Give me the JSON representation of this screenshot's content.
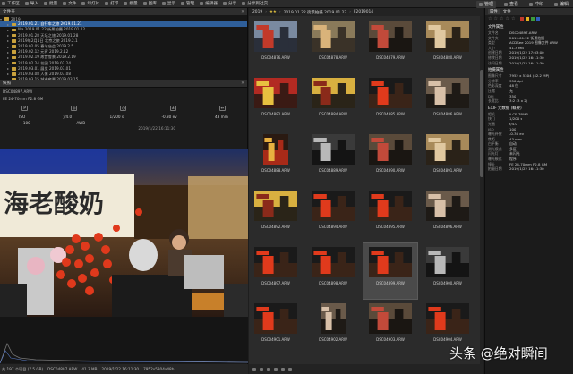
{
  "toolbar": {
    "items": [
      {
        "label": "工作区",
        "icon": "workspace-icon"
      },
      {
        "label": "导入",
        "icon": "import-icon"
      },
      {
        "label": "批量",
        "icon": "batch-icon"
      },
      {
        "label": "文件",
        "icon": "file-icon"
      },
      {
        "label": "幻灯片",
        "icon": "slideshow-icon"
      },
      {
        "label": "打印",
        "icon": "print-icon"
      },
      {
        "label": "批量",
        "icon": "batch2-icon"
      },
      {
        "label": "图库",
        "icon": "gallery-icon"
      },
      {
        "label": "显示",
        "icon": "display-icon"
      },
      {
        "label": "管理",
        "icon": "manage-icon"
      },
      {
        "label": "编辑器",
        "icon": "editor-icon"
      },
      {
        "label": "分享",
        "icon": "share-icon"
      },
      {
        "label": "分享到社交",
        "icon": "social-icon"
      }
    ],
    "mode_tabs": [
      {
        "label": "管理",
        "active": true
      },
      {
        "label": "查看",
        "active": false
      },
      {
        "label": "冲印",
        "active": false
      },
      {
        "label": "编辑",
        "active": false
      }
    ]
  },
  "folders": {
    "title": "文件夹",
    "root": "2019",
    "items": [
      {
        "label": "2019.01.21 自行车之旅 2019.01.21",
        "selected": true
      },
      {
        "label": "Wa 2019.01.22 街景拍摄 2019.01.22",
        "selected": false
      },
      {
        "label": "2019.01.28 天坛之旅 2019.01.28",
        "selected": false
      },
      {
        "label": "2019年2月1日 北京之旅 2019.2.1",
        "selected": false
      },
      {
        "label": "2019.02.05 春节庙会 2019.2.5",
        "selected": false
      },
      {
        "label": "2019.02.12 元宵 2019.2.12",
        "selected": false
      },
      {
        "label": "2019.02.19 故宫雪景 2019.2.19",
        "selected": false
      },
      {
        "label": "2019.02.24 花园 2019.02.24",
        "selected": false
      },
      {
        "label": "2019.03.01 展览 2019.03.01",
        "selected": false
      },
      {
        "label": "2019.03.08 人像 2019.03.08",
        "selected": false
      },
      {
        "label": "2019.03.15 城市夜景 2019.03.15",
        "selected": false
      }
    ]
  },
  "palette": {
    "title": "快照",
    "file": "DSC04897.ARW",
    "lens": "FE 24-70mm F2.8 GM",
    "mode": "P",
    "aperture": "ƒ/4.0",
    "shutter": "1/200 s",
    "ev": "-0.30 ev",
    "focal": "43 mm",
    "iso_label": "ISO",
    "iso": "100",
    "wb": "AWB",
    "datetime": "2019/1/22 16:11:30"
  },
  "left_status": {
    "count": "共 197 个项目 (7.5 GB)",
    "file": "DSC04897.ARW",
    "size": "41.3 MB",
    "date": "2019/1/22 16:11:30",
    "dims": "7952x5304x48b"
  },
  "breadcrumb": {
    "parts": [
      "2019",
      "★★",
      "2019.01.22 街景拍摄 2019.01.22",
      "F2019014"
    ]
  },
  "thumbnails": [
    {
      "name": "DSC04876.ARW",
      "scene": "street-blue",
      "orientation": "landscape",
      "selected": false
    },
    {
      "name": "DSC04878.ARW",
      "scene": "alley",
      "orientation": "landscape",
      "selected": false
    },
    {
      "name": "DSC04879.ARW",
      "scene": "crowd",
      "orientation": "landscape",
      "selected": false
    },
    {
      "name": "DSC04880.ARW",
      "scene": "shop",
      "orientation": "landscape",
      "selected": false
    },
    {
      "name": "DSC04882.ARW",
      "scene": "red-stall",
      "orientation": "landscape",
      "selected": false
    },
    {
      "name": "DSC04884.ARW",
      "scene": "yellow-sign",
      "orientation": "landscape",
      "selected": false
    },
    {
      "name": "DSC04885.ARW",
      "scene": "candy",
      "orientation": "landscape",
      "selected": false
    },
    {
      "name": "DSC04886.ARW",
      "scene": "people",
      "orientation": "landscape",
      "selected": false
    },
    {
      "name": "DSC04888.ARW",
      "scene": "lantern",
      "orientation": "portrait",
      "selected": false
    },
    {
      "name": "DSC04889.ARW",
      "scene": "street-dark",
      "orientation": "landscape",
      "selected": false
    },
    {
      "name": "DSC04890.ARW",
      "scene": "crowd",
      "orientation": "landscape",
      "selected": false
    },
    {
      "name": "DSC04891.ARW",
      "scene": "shop",
      "orientation": "landscape",
      "selected": false
    },
    {
      "name": "DSC04892.ARW",
      "scene": "yellow-sign",
      "orientation": "landscape",
      "selected": false
    },
    {
      "name": "DSC04894.ARW",
      "scene": "candy",
      "orientation": "landscape",
      "selected": false
    },
    {
      "name": "DSC04895.ARW",
      "scene": "candy",
      "orientation": "landscape",
      "selected": false
    },
    {
      "name": "DSC04896.ARW",
      "scene": "people",
      "orientation": "landscape",
      "selected": false
    },
    {
      "name": "DSC04897.ARW",
      "scene": "candy",
      "orientation": "landscape",
      "selected": false
    },
    {
      "name": "DSC04898.ARW",
      "scene": "candy",
      "orientation": "landscape",
      "selected": false
    },
    {
      "name": "DSC04899.ARW",
      "scene": "candy",
      "orientation": "landscape",
      "selected": true
    },
    {
      "name": "DSC04900.ARW",
      "scene": "street-dark",
      "orientation": "landscape",
      "selected": false
    },
    {
      "name": "DSC04901.ARW",
      "scene": "candy",
      "orientation": "landscape",
      "selected": false
    },
    {
      "name": "DSC04902.ARW",
      "scene": "people",
      "orientation": "portrait",
      "selected": false
    },
    {
      "name": "DSC04903.ARW",
      "scene": "crowd",
      "orientation": "landscape",
      "selected": false
    },
    {
      "name": "DSC04904.ARW",
      "scene": "candy",
      "orientation": "landscape",
      "selected": false
    }
  ],
  "info": {
    "tabs": [
      "属性",
      "文件"
    ],
    "section_file": "文件属性",
    "section_photo": "拍摄属性",
    "section_exif": "EXIF 元数据 (概要)",
    "file_props": [
      {
        "k": "文件名",
        "v": "DSC04897.ARW"
      },
      {
        "k": "文件夹",
        "v": "2019.01.22 街景拍摄"
      },
      {
        "k": "类型",
        "v": "ACDSee 2019 图像文件 ARW"
      },
      {
        "k": "大小",
        "v": "41.3 MB"
      },
      {
        "k": "创建日期",
        "v": "2019/1/22 17:03:00"
      },
      {
        "k": "修改日期",
        "v": "2019/1/22 16:11:30"
      },
      {
        "k": "访问日期",
        "v": "2019/1/22 16:11:30"
      }
    ],
    "photo_props": [
      {
        "k": "图像尺寸",
        "v": "7952 x 5304 (42.2 MP)"
      },
      {
        "k": "分辨率",
        "v": "350 dpi"
      },
      {
        "k": "色彩深度",
        "v": "48 位"
      },
      {
        "k": "压缩",
        "v": "无"
      },
      {
        "k": "DPI",
        "v": "350"
      },
      {
        "k": "长宽比",
        "v": "3:2 (3 x 2)"
      }
    ],
    "exif": [
      {
        "k": "相机",
        "v": "ILCE-7RM3"
      },
      {
        "k": "快门",
        "v": "1/200 s"
      },
      {
        "k": "光圈",
        "v": "f/4.0"
      },
      {
        "k": "ISO",
        "v": "100"
      },
      {
        "k": "曝光补偿",
        "v": "-0.30 ev"
      },
      {
        "k": "焦距",
        "v": "43 mm"
      },
      {
        "k": "白平衡",
        "v": "自动"
      },
      {
        "k": "测光模式",
        "v": "多区"
      },
      {
        "k": "闪光灯",
        "v": "未闪光"
      },
      {
        "k": "曝光模式",
        "v": "程序"
      },
      {
        "k": "镜头",
        "v": "FE 24-70mm F2.8 GM"
      },
      {
        "k": "拍摄日期",
        "v": "2019/1/22 16:11:30"
      }
    ]
  },
  "watermark": "头条 @绝对瞬间",
  "preview_sign": "海老酸奶"
}
